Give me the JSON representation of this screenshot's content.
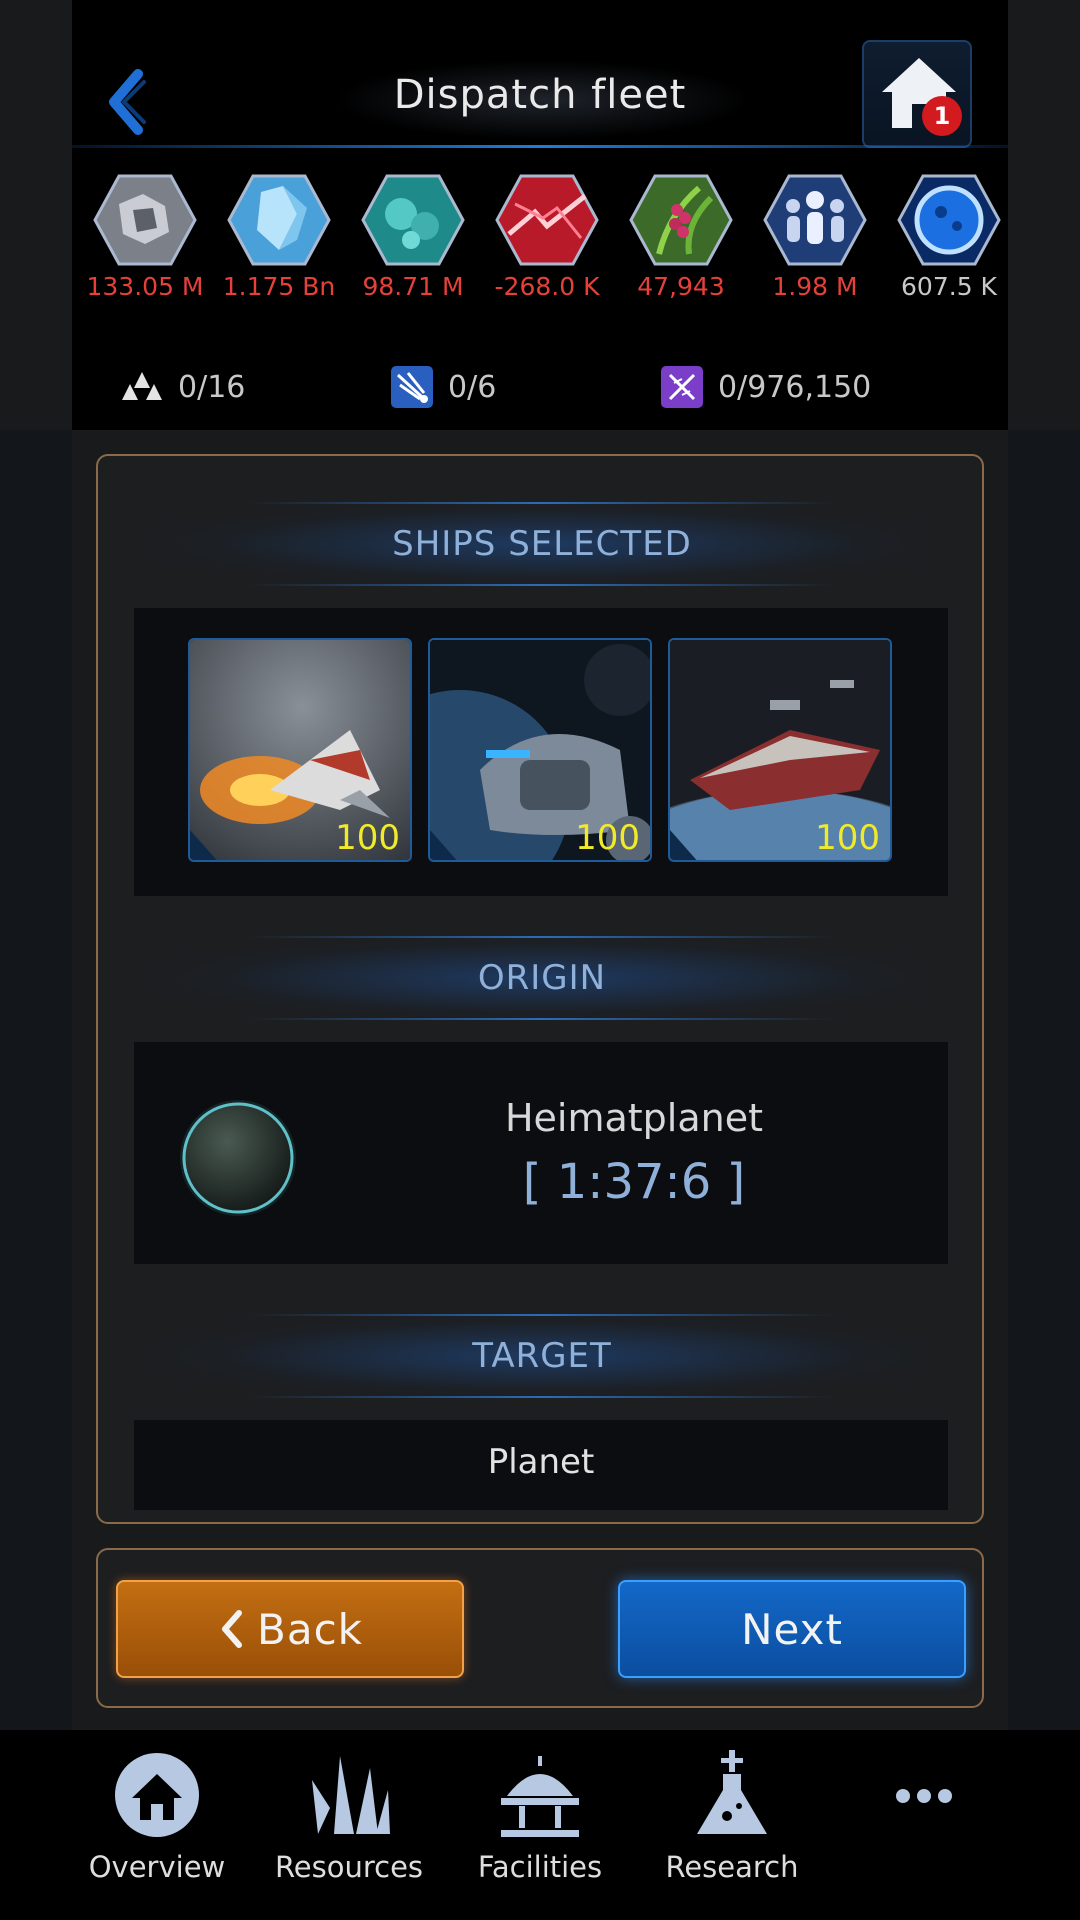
{
  "header": {
    "title": "Dispatch fleet",
    "home_badge": "1"
  },
  "resources": [
    {
      "icon": "metal-ore-icon",
      "value": "133.05 M",
      "color": "#e5403a"
    },
    {
      "icon": "crystal-icon",
      "value": "1.175 Bn",
      "color": "#e5403a"
    },
    {
      "icon": "deuterium-icon",
      "value": "98.71 M",
      "color": "#e5403a"
    },
    {
      "icon": "energy-icon",
      "value": "-268.0 K",
      "color": "#e5403a"
    },
    {
      "icon": "food-icon",
      "value": "47,943",
      "color": "#e5403a"
    },
    {
      "icon": "population-icon",
      "value": "1.98 M",
      "color": "#e5403a"
    },
    {
      "icon": "research-orb-icon",
      "value": "607.5 K",
      "color": "#c8c8c8"
    }
  ],
  "counters": {
    "fleet_slots": "0/16",
    "expedition_slots": "0/6",
    "dna": "0/976,150"
  },
  "sections": {
    "ships_title": "SHIPS SELECTED",
    "origin_title": "ORIGIN",
    "target_title": "TARGET"
  },
  "ships": [
    {
      "name": "fighter",
      "count": "100"
    },
    {
      "name": "transporter",
      "count": "100"
    },
    {
      "name": "cruiser",
      "count": "100"
    }
  ],
  "origin": {
    "name": "Heimatplanet",
    "coords": "[ 1:37:6 ]"
  },
  "target": {
    "label": "Planet"
  },
  "buttons": {
    "back": "Back",
    "next": "Next"
  },
  "nav": {
    "overview": "Overview",
    "resources": "Resources",
    "facilities": "Facilities",
    "research": "Research"
  },
  "colors": {
    "accent_blue": "#1e7ce0",
    "negative_red": "#e5403a",
    "count_yellow": "#f0ea2a",
    "panel_border": "#8a6a48"
  }
}
